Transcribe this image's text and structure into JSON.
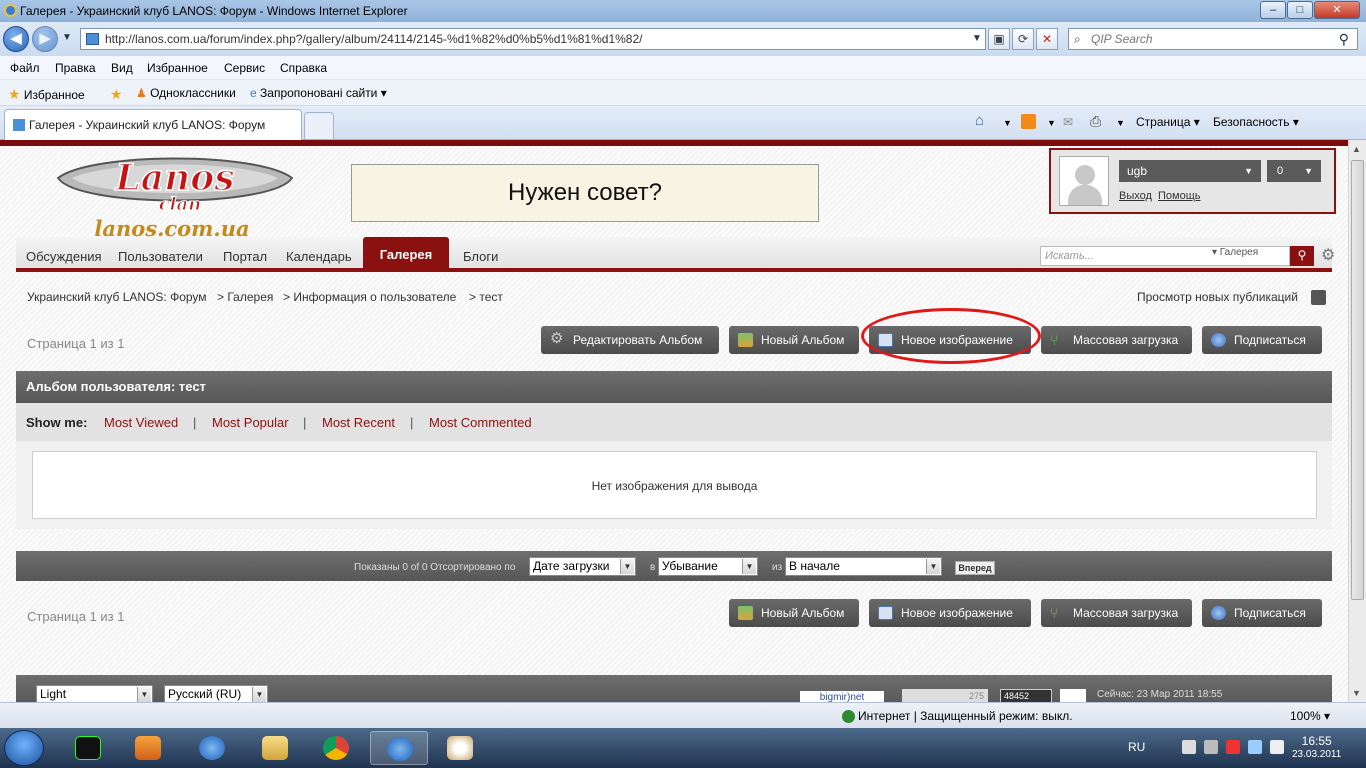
{
  "window": {
    "title": "Галерея - Украинский клуб LANOS: Форум - Windows Internet Explorer",
    "url": "http://lanos.com.ua/forum/index.php?/gallery/album/24114/2145-%d1%82%d0%b5%d1%81%d1%82/",
    "search_placeholder": "QIP Search",
    "controls": {
      "minimize": "–",
      "maximize": "□",
      "close": "✕"
    }
  },
  "menu": [
    "Файл",
    "Правка",
    "Вид",
    "Избранное",
    "Сервис",
    "Справка"
  ],
  "favorites_bar": {
    "favorites": "Избранное",
    "odnoklassniki": "Одноклассники",
    "suggested": "Запропоновані сайти ▾"
  },
  "tab": {
    "title": "Галерея - Украинский клуб LANOS: Форум"
  },
  "toolbar_right": {
    "page": "Страница ▾",
    "safety": "Безопасность ▾"
  },
  "site": {
    "logo_text": "Lanos",
    "logo_sub": "clan",
    "logo_url": "lanos.com.ua",
    "banner": "Нужен совет?",
    "user": {
      "name": "ugb",
      "count": "0",
      "logout": "Выход",
      "help": "Помощь"
    },
    "nav": [
      "Обсуждения",
      "Пользователи",
      "Портал",
      "Календарь",
      "Галерея",
      "Блоги"
    ],
    "nav_active": "Галерея",
    "search_placeholder": "Искать...",
    "search_scope": "▾ Галерея",
    "breadcrumb": [
      "Украинский клуб LANOS: Форум",
      "> Галерея",
      "> Информация о пользователе",
      "> тест"
    ],
    "new_posts": "Просмотр новых публикаций",
    "pager": "Страница 1 из 1",
    "buttons_top": [
      "Редактировать Альбом",
      "Новый Альбом",
      "Новое изображение",
      "Массовая загрузка",
      "Подписаться"
    ],
    "buttons_bottom": [
      "Новый Альбом",
      "Новое изображение",
      "Массовая загрузка",
      "Подписаться"
    ],
    "album_header": "Альбом пользователя: тест",
    "show_me": {
      "label": "Show me:",
      "links": [
        "Most Viewed",
        "Most Popular",
        "Most Recent",
        "Most Commented"
      ],
      "sep": "|"
    },
    "empty_message": "Нет изображения для вывода",
    "sort": {
      "shown": "Показаны 0 of 0 Отсортировано по",
      "field": "Дате загрузки",
      "word_in": "в",
      "order": "Убывание",
      "word_from": "из",
      "from": "В начале",
      "go": "Вперед"
    },
    "footer": {
      "skin": "Light",
      "language": "Русский (RU)",
      "counter1": "bigmir)net",
      "counter2": "275",
      "counter3": "48452",
      "now": "Сейчас: 23 Мар 2011 18:55"
    },
    "colors": {
      "accent": "#8b1010",
      "highlight": "#e01818",
      "bar": "#5e5e5e"
    }
  },
  "statusbar": {
    "status": "Интернет | Защищенный режим: выкл.",
    "zoom": "100% ▾"
  },
  "taskbar": {
    "lang": "RU",
    "time": "16:55",
    "date": "23.03.2011"
  }
}
